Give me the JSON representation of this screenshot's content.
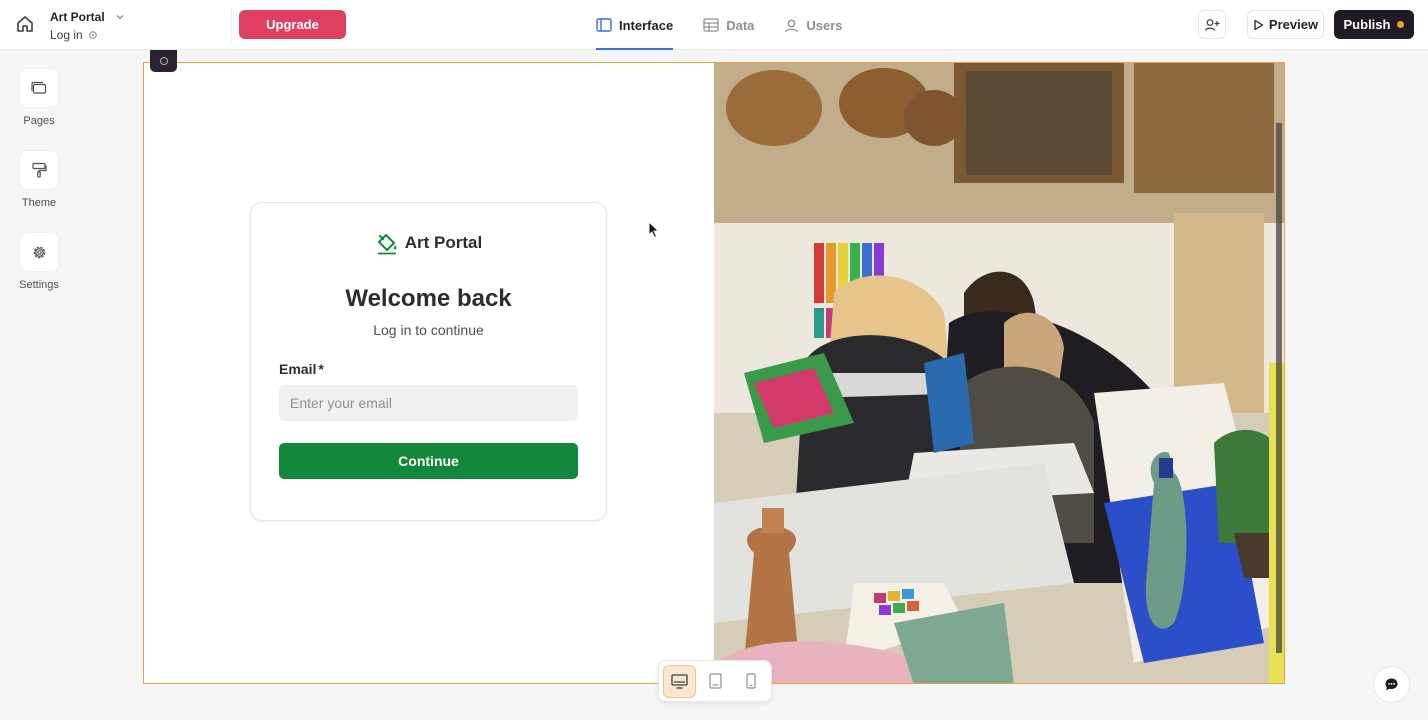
{
  "topbar": {
    "app_name": "Art Portal",
    "page_name": "Log in",
    "upgrade_label": "Upgrade",
    "tabs": [
      {
        "label": "Interface",
        "icon": "layout-icon",
        "active": true
      },
      {
        "label": "Data",
        "icon": "table-icon",
        "active": false
      },
      {
        "label": "Users",
        "icon": "user-icon",
        "active": false
      }
    ],
    "preview_label": "Preview",
    "publish_label": "Publish",
    "publish_status_color": "#f0a91b"
  },
  "sidebar": {
    "items": [
      {
        "label": "Pages",
        "icon": "pages-icon"
      },
      {
        "label": "Theme",
        "icon": "paint-roller-icon"
      },
      {
        "label": "Settings",
        "icon": "gear-icon"
      }
    ]
  },
  "login": {
    "brand_name": "Art Portal",
    "title": "Welcome back",
    "subtitle": "Log in to continue",
    "email_label": "Email",
    "required_marker": "*",
    "email_placeholder": "Enter your email",
    "email_value": "",
    "continue_label": "Continue",
    "brand_color": "#13873b"
  },
  "device_switcher": {
    "options": [
      "desktop-icon",
      "tablet-icon",
      "mobile-icon"
    ],
    "selected": "desktop-icon"
  },
  "colors": {
    "upgrade": "#df3f62",
    "publish": "#1f1a23",
    "active_tab_underline": "#3d6fd8",
    "canvas_border": "#f0a23a"
  }
}
